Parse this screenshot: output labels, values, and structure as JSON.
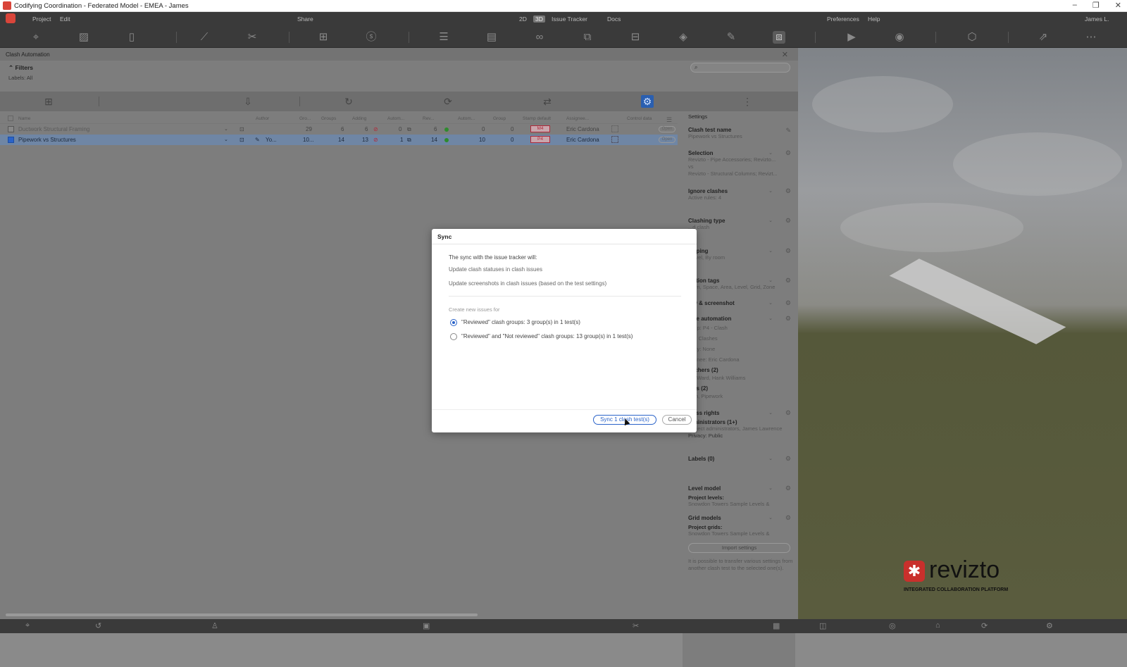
{
  "window": {
    "title": "Codifying Coordination - Federated Model - EMEA - James",
    "controls": [
      "minimize",
      "restore",
      "close"
    ]
  },
  "menubar": {
    "project": "Project",
    "edit": "Edit",
    "share": "Share",
    "mode_2d": "2D",
    "mode_3d": "3D",
    "issue_tracker": "Issue Tracker",
    "docs": "Docs",
    "preferences": "Preferences",
    "help": "Help",
    "user": "James L."
  },
  "panel": {
    "title": "Clash Automation",
    "filters_label": "Filters",
    "labels_filter": "Labels: All",
    "table": {
      "columns": [
        "Name",
        "Author",
        "Gro...",
        "Groups",
        "Adding",
        "Autom...",
        "Rev...",
        "Autom...",
        "Group",
        "Stamp default",
        "Assignee...",
        "Control data"
      ],
      "rows": [
        {
          "name": "Ductwork Structural Framing",
          "author": "",
          "count1": "29",
          "groups": "6",
          "adding": "6",
          "autom": "0",
          "rev": "6",
          "autom2": "0",
          "group": "0",
          "stamp": "M4",
          "assignee": "Eric Cardona",
          "status": "Open",
          "selected": false
        },
        {
          "name": "Pipework vs Structures",
          "author": "Yo...",
          "count1": "10...",
          "groups": "14",
          "adding": "13",
          "autom": "1",
          "rev": "14",
          "autom2": "10",
          "group": "0",
          "stamp": "P4",
          "assignee": "Eric Cardona",
          "status": "Open",
          "selected": true
        }
      ]
    }
  },
  "settings": {
    "header": "Settings",
    "clash_test_name_label": "Clash test name",
    "clash_test_name_value": "Pipework vs Structures",
    "selection_label": "Selection",
    "selection_value1": "Revizto - Pipe Accessories; Revizto...",
    "selection_vs": "vs",
    "selection_value2": "Revizto - Structural Columns; Revizt...",
    "ignore_label": "Ignore clashes",
    "ignore_value": "Active rules: 4",
    "clashing_type_label": "Clashing type",
    "clashing_type_value": "...d clash",
    "grouping_label": "...uping",
    "grouping_value": "...evel, By room",
    "location_tags_label": "...ation tags",
    "location_tags_value": "...om, Space, Area, Level, Grid, Zone",
    "view_label": "...w & screenshot",
    "issue_auto_label": "...ue automation",
    "issue_auto_stamp": "...mp: P4 - Clash",
    "issue_auto_type": "...e: Clashes",
    "issue_auto_priority": "...rity: None",
    "issue_auto_assignee": "...ignee: Eric Cardona",
    "watchers_label": "...tchers (2)",
    "watchers_value": "...k Ward, Hank Williams",
    "tags_label": "...gs (2)",
    "tags_value": "...sh, Pipework",
    "access_label": "...ess rights",
    "access_admins": "...ministrators (1+)",
    "access_value": "Project administrators, James Lawrence",
    "privacy": "Privacy: Public",
    "labels_label": "Labels (0)",
    "level_model_label": "Level model",
    "level_project_levels": "Project levels:",
    "level_value": "Snowdon Towers Sample Levels &",
    "grid_models_label": "Grid models",
    "grid_project_grids": "Project grids:",
    "grid_value": "Snowdon Towers Sample Levels &",
    "import_button": "Import settings",
    "import_note": "It is possible to transfer various settings from another clash test to the selected one(s)."
  },
  "dialog": {
    "title": "Sync",
    "intro": "The sync with the issue tracker will:",
    "line1": "Update clash statuses in clash issues",
    "line2": "Update screenshots in clash issues (based on the test settings)",
    "create_label": "Create new issues for",
    "option1": "\"Reviewed\" clash groups: 3 group(s) in 1 test(s)",
    "option2": "\"Reviewed\" and \"Not reviewed\" clash groups: 13 group(s) in 1 test(s)",
    "selected_option": 1,
    "primary_button": "Sync 1 clash test(s)",
    "cancel_button": "Cancel"
  },
  "brand": {
    "name": "revizto",
    "tagline": "INTEGRATED COLLABORATION PLATFORM",
    "color": "#c9302c"
  },
  "colors": {
    "accent": "#2a63c9",
    "toolbar_bg": "#3a3a3a",
    "selected_row": "#6f86a5"
  },
  "icons": {
    "toolbar": [
      "location-pin-icon",
      "map-icon",
      "sheet-icon",
      "ruler-icon",
      "scissors-icon",
      "add-issue-icon",
      "stamp-icon",
      "layers-icon",
      "table-icon",
      "binoculars-icon",
      "compare-icon",
      "filter-icon",
      "paint-icon",
      "markup-icon",
      "clash-automation-icon",
      "video-icon",
      "camera-icon",
      "cube-icon",
      "export-icon",
      "more-icon"
    ]
  }
}
